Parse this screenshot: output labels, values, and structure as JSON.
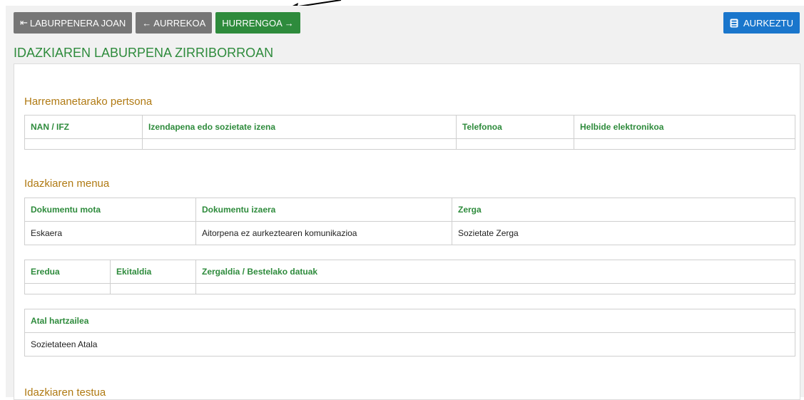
{
  "toolbar": {
    "first_label": "LABURPENERA JOAN",
    "prev_label": "AURREKOA",
    "next_label": "HURRENGOA",
    "submit_label": "AURKEZTU"
  },
  "icons": {
    "first": "first-page-arrow-icon",
    "prev": "arrow-left-icon",
    "next": "arrow-right-icon",
    "submit": "shield-icon",
    "annotation": "pointer-arrow-icon"
  },
  "page_title": "IDAZKIAREN LABURPENA ZIRRIBORROAN",
  "contact": {
    "title": "Harremanetarako pertsona",
    "headers": [
      "NAN / IFZ",
      "Izendapena edo sozietate izena",
      "Telefonoa",
      "Helbide elektronikoa"
    ],
    "row": [
      "",
      "",
      "",
      ""
    ]
  },
  "menu": {
    "title": "Idazkiaren menua",
    "headers": [
      "Dokumentu mota",
      "Dokumentu izaera",
      "Zerga"
    ],
    "row": [
      "Eskaera",
      "Aitorpena ez aurkeztearen komunikazioa",
      "Sozietate Zerga"
    ]
  },
  "model": {
    "headers": [
      "Eredua",
      "Ekitaldia",
      "Zergaldia / Bestelako datuak"
    ],
    "row": [
      "",
      "",
      ""
    ]
  },
  "receiver": {
    "header": "Atal hartzailea",
    "value": "Sozietateen Atala"
  },
  "text_section": {
    "title": "Idazkiaren testua"
  },
  "colors": {
    "green": "#2e8b3c",
    "grey": "#767676",
    "blue": "#1a76cc",
    "section": "#b07a13"
  }
}
